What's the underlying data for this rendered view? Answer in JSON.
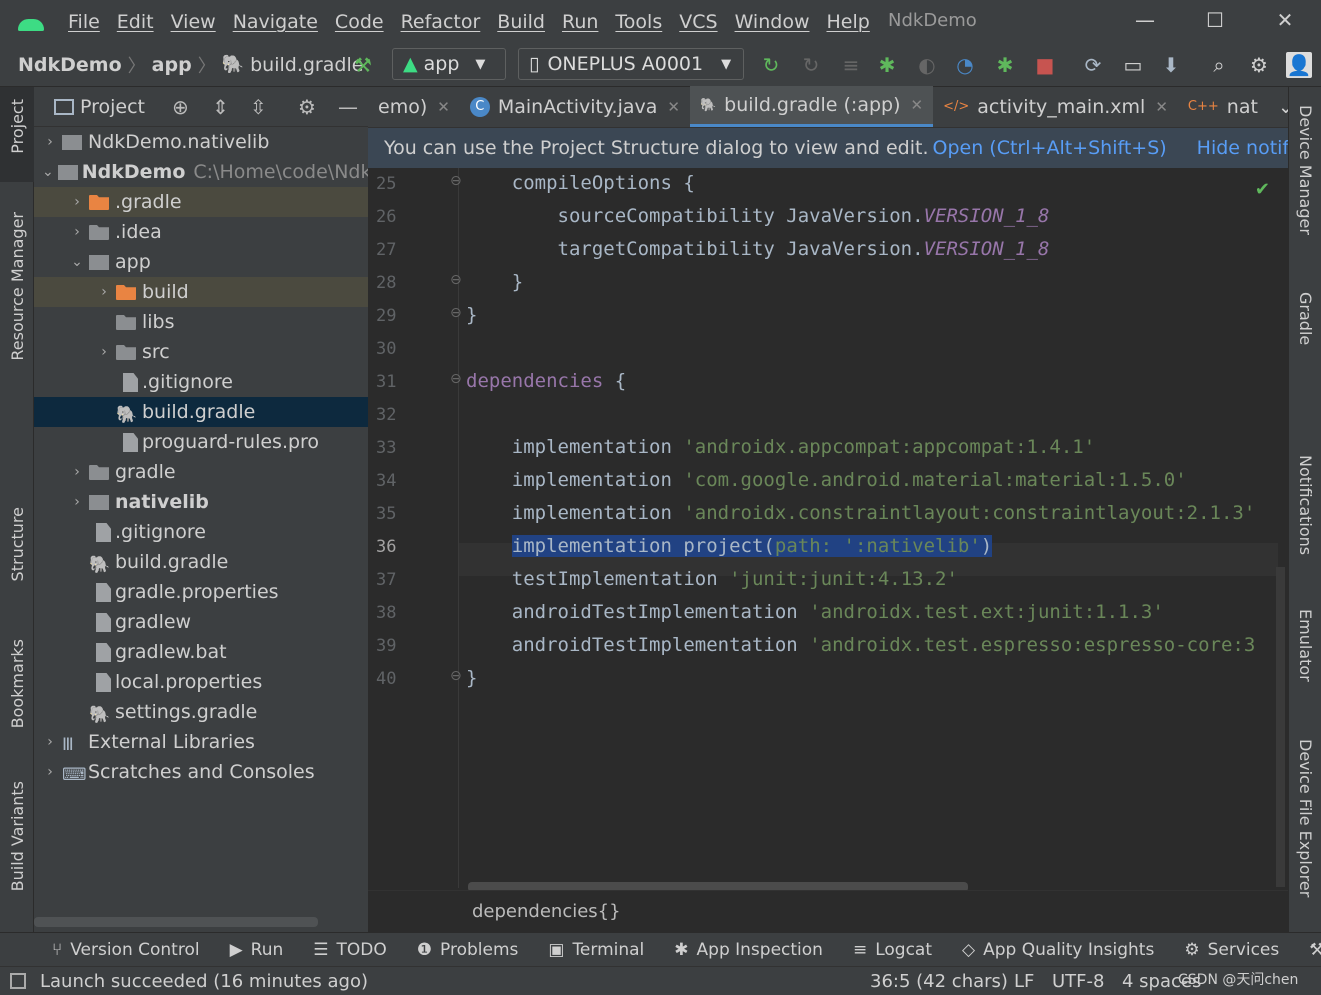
{
  "menubar": {
    "items": [
      "File",
      "Edit",
      "View",
      "Navigate",
      "Code",
      "Refactor",
      "Build",
      "Run",
      "Tools",
      "VCS",
      "Window",
      "Help"
    ],
    "title": "NdkDemo"
  },
  "toolbar": {
    "breadcrumb": [
      "NdkDemo",
      "app",
      "build.gradle"
    ],
    "config": "app",
    "device": "ONEPLUS A0001"
  },
  "left_stripe": [
    "Project",
    "Resource Manager",
    "Structure",
    "Bookmarks",
    "Build Variants"
  ],
  "right_stripe": [
    "Device Manager",
    "Gradle",
    "Notifications",
    "Emulator",
    "Device File Explorer"
  ],
  "project_panel": {
    "title": "Project",
    "tree": [
      {
        "label": "NdkDemo.nativelib",
        "indent": 0,
        "arrow": "›",
        "icon": "mod",
        "hint": ""
      },
      {
        "label": "NdkDemo",
        "indent": 0,
        "arrow": "⌄",
        "icon": "mod",
        "bold": true,
        "hint": "C:\\Home\\code\\Ndk"
      },
      {
        "label": ".gradle",
        "indent": 1,
        "arrow": "›",
        "icon": "folder-orange",
        "hint": ""
      },
      {
        "label": ".idea",
        "indent": 1,
        "arrow": "›",
        "icon": "folder",
        "hint": ""
      },
      {
        "label": "app",
        "indent": 1,
        "arrow": "⌄",
        "icon": "mod",
        "hint": ""
      },
      {
        "label": "build",
        "indent": 2,
        "arrow": "›",
        "icon": "folder-orange",
        "hint": ""
      },
      {
        "label": "libs",
        "indent": 2,
        "arrow": "",
        "icon": "folder",
        "hint": ""
      },
      {
        "label": "src",
        "indent": 2,
        "arrow": "›",
        "icon": "folder",
        "hint": ""
      },
      {
        "label": ".gitignore",
        "indent": 2,
        "arrow": "",
        "icon": "file",
        "hint": ""
      },
      {
        "label": "build.gradle",
        "indent": 2,
        "arrow": "",
        "icon": "gradle",
        "hint": ""
      },
      {
        "label": "proguard-rules.pro",
        "indent": 2,
        "arrow": "",
        "icon": "file",
        "hint": ""
      },
      {
        "label": "gradle",
        "indent": 1,
        "arrow": "›",
        "icon": "folder",
        "hint": ""
      },
      {
        "label": "nativelib",
        "indent": 1,
        "arrow": "›",
        "icon": "mod",
        "bold": true,
        "hint": ""
      },
      {
        "label": ".gitignore",
        "indent": 1,
        "arrow": "",
        "icon": "file",
        "hint": ""
      },
      {
        "label": "build.gradle",
        "indent": 1,
        "arrow": "",
        "icon": "gradle",
        "hint": ""
      },
      {
        "label": "gradle.properties",
        "indent": 1,
        "arrow": "",
        "icon": "file",
        "hint": ""
      },
      {
        "label": "gradlew",
        "indent": 1,
        "arrow": "",
        "icon": "file",
        "hint": ""
      },
      {
        "label": "gradlew.bat",
        "indent": 1,
        "arrow": "",
        "icon": "file",
        "hint": ""
      },
      {
        "label": "local.properties",
        "indent": 1,
        "arrow": "",
        "icon": "file",
        "hint": ""
      },
      {
        "label": "settings.gradle",
        "indent": 1,
        "arrow": "",
        "icon": "gradle",
        "hint": ""
      },
      {
        "label": "External Libraries",
        "indent": 0,
        "arrow": "›",
        "icon": "lib",
        "hint": ""
      },
      {
        "label": "Scratches and Consoles",
        "indent": 0,
        "arrow": "›",
        "icon": "scratch",
        "hint": ""
      }
    ]
  },
  "editor": {
    "tabs": [
      "emo)",
      "MainActivity.java",
      "build.gradle (:app)",
      "activity_main.xml",
      "nat"
    ],
    "active_tab": 2,
    "notification": {
      "text": "You can use the Project Structure dialog to view and edit.",
      "open": "Open (Ctrl+Alt+Shift+S)",
      "hide": "Hide notification"
    },
    "line_numbers": [
      "25",
      "26",
      "27",
      "28",
      "29",
      "30",
      "31",
      "32",
      "33",
      "34",
      "35",
      "36",
      "37",
      "38",
      "39",
      "40"
    ],
    "current_line": "36",
    "lines": [
      {
        "indent": "    ",
        "parts": [
          {
            "t": "compileOptions {",
            "c": "plain"
          }
        ]
      },
      {
        "indent": "        ",
        "parts": [
          {
            "t": "sourceCompatibility JavaVersion.",
            "c": "plain"
          },
          {
            "t": "VERSION_1_8",
            "c": "ital"
          }
        ]
      },
      {
        "indent": "        ",
        "parts": [
          {
            "t": "targetCompatibility JavaVersion.",
            "c": "plain"
          },
          {
            "t": "VERSION_1_8",
            "c": "ital"
          }
        ]
      },
      {
        "indent": "    ",
        "parts": [
          {
            "t": "}",
            "c": "plain"
          }
        ]
      },
      {
        "indent": "",
        "parts": [
          {
            "t": "}",
            "c": "plain"
          }
        ]
      },
      {
        "indent": "",
        "parts": []
      },
      {
        "indent": "",
        "parts": [
          {
            "t": "dependencies",
            "c": "dep"
          },
          {
            "t": " {",
            "c": "plain"
          }
        ]
      },
      {
        "indent": "",
        "parts": []
      },
      {
        "indent": "    ",
        "parts": [
          {
            "t": "implementation ",
            "c": "plain"
          },
          {
            "t": "'androidx.appcompat:appcompat:1.4.1'",
            "c": "str"
          }
        ]
      },
      {
        "indent": "    ",
        "parts": [
          {
            "t": "implementation ",
            "c": "plain"
          },
          {
            "t": "'com.google.android.material:material:1.5.0'",
            "c": "str"
          }
        ]
      },
      {
        "indent": "    ",
        "parts": [
          {
            "t": "implementation ",
            "c": "plain"
          },
          {
            "t": "'androidx.constraintlayout:constraintlayout:2.1.3'",
            "c": "str"
          }
        ]
      },
      {
        "indent": "    ",
        "parts": [
          {
            "t": "implementation project(",
            "c": "sel"
          },
          {
            "t": "path: ",
            "c": "selparam"
          },
          {
            "t": "':nativelib'",
            "c": "selstr"
          },
          {
            "t": ")",
            "c": "sel"
          }
        ]
      },
      {
        "indent": "    ",
        "parts": [
          {
            "t": "testImplementation ",
            "c": "plain"
          },
          {
            "t": "'junit:junit:4.13.2'",
            "c": "str"
          }
        ]
      },
      {
        "indent": "    ",
        "parts": [
          {
            "t": "androidTestImplementation ",
            "c": "plain"
          },
          {
            "t": "'androidx.test.ext:junit:1.1.3'",
            "c": "str"
          }
        ]
      },
      {
        "indent": "    ",
        "parts": [
          {
            "t": "androidTestImplementation ",
            "c": "plain"
          },
          {
            "t": "'androidx.test.espresso:espresso-core:3",
            "c": "str"
          }
        ]
      },
      {
        "indent": "",
        "parts": [
          {
            "t": "}",
            "c": "plain"
          }
        ]
      }
    ],
    "breadcrumb": "dependencies{}"
  },
  "bottom_tools": [
    "Version Control",
    "Run",
    "TODO",
    "Problems",
    "Terminal",
    "App Inspection",
    "Logcat",
    "App Quality Insights",
    "Services",
    "Bu"
  ],
  "status": {
    "message": "Launch succeeded (16 minutes ago)",
    "position": "36:5 (42 chars)",
    "line_sep": "LF",
    "encoding": "UTF-8",
    "indent": "4 spaces",
    "watermark": "CSDN @天问chen"
  },
  "colors": {
    "accent": "#4a88c7",
    "selection": "#214283",
    "string": "#6a8759",
    "keyword_purple": "#9876aa"
  }
}
